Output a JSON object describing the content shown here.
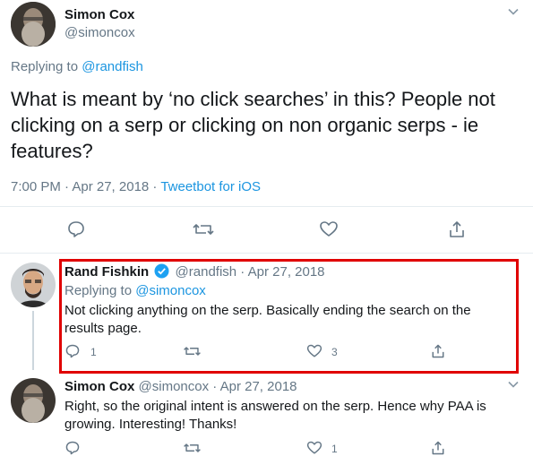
{
  "main_tweet": {
    "author_name": "Simon Cox",
    "author_handle": "@simoncox",
    "replying_prefix": "Replying to",
    "replying_to": "@randfish",
    "text": "What is meant by ‘no click searches’ in this? People not clicking on a serp or clicking on non organic serps - ie features?",
    "time": "7:00 PM · Apr 27, 2018 · ",
    "source": "Tweetbot for iOS"
  },
  "reply_1": {
    "author_name": "Rand Fishkin",
    "author_handle": "@randfish",
    "date": " · Apr 27, 2018",
    "replying_prefix": "Replying to",
    "replying_to": "@simoncox",
    "text": "Not clicking anything on the serp. Basically ending the search on the results page.",
    "reply_count": "1",
    "like_count": "3"
  },
  "reply_2": {
    "author_name": "Simon Cox",
    "author_handle": "@simoncox",
    "date": " · Apr 27, 2018",
    "text": "Right, so the original intent is answered on the serp. Hence why PAA is growing. Interesting! Thanks!",
    "like_count": "1"
  },
  "colors": {
    "accent": "#1b95e0",
    "verified": "#1da1f2",
    "highlight_border": "#e00000",
    "icon": "#657786"
  }
}
